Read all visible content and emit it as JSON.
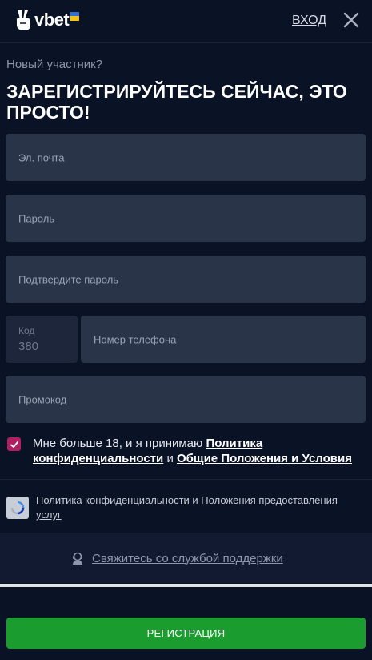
{
  "header": {
    "logo_text": "vbet",
    "login_label": "ВХОД"
  },
  "form": {
    "subtitle": "Новый участник?",
    "headline": "ЗАРЕГИСТРИРУЙТЕСЬ СЕЙЧАС, ЭТО ПРОСТО!",
    "email_placeholder": "Эл. почта",
    "password_placeholder": "Пароль",
    "confirm_placeholder": "Подтвердите пароль",
    "code_label": "Код",
    "code_value": "380",
    "phone_placeholder": "Номер телефона",
    "promo_placeholder": "Промокод"
  },
  "agreement": {
    "checked": true,
    "text_before": "Мне больше 18, и я принимаю ",
    "privacy_link": "Политика конфиденциальности",
    "and": " и ",
    "terms_link": "Общие Положения и Условия"
  },
  "recaptcha": {
    "privacy_link": "Политика конфиденциальности",
    "and": " и ",
    "terms_link": "Положения предоставления услуг"
  },
  "support": {
    "label": "Свяжитесь со службой поддержки"
  },
  "register_button": "РЕГИСТРАЦИЯ",
  "colors": {
    "background": "#0a1226",
    "field": "#2a3448",
    "accent": "#b11f63",
    "button": "#1a9c2f"
  }
}
